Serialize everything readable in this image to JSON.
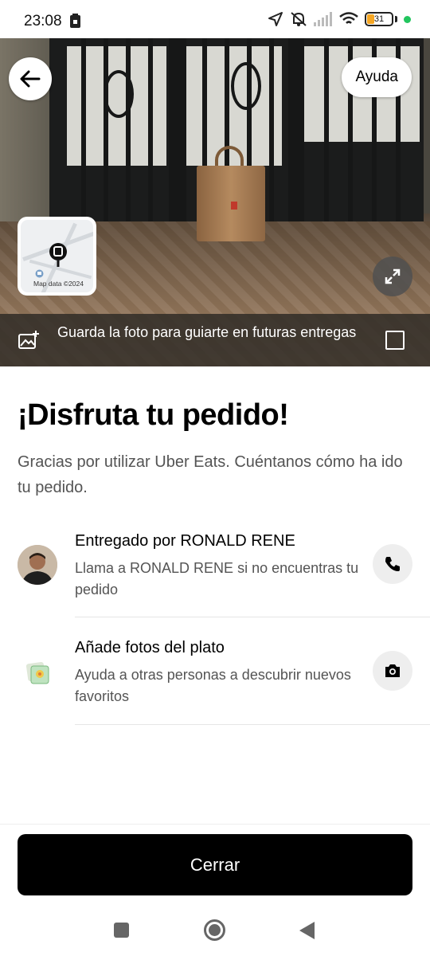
{
  "status_bar": {
    "time": "23:08",
    "battery_level": "31",
    "battery_fraction": 0.31,
    "icons": [
      "save-icon",
      "location-arrow-icon",
      "muted-bell-icon",
      "signal-icon",
      "wifi-icon",
      "battery-icon",
      "status-dot-icon"
    ],
    "accent_color": "#22c55e"
  },
  "header": {
    "help_label": "Ayuda",
    "back_icon": "arrow-left-icon",
    "expand_icon": "expand-icon"
  },
  "map": {
    "attribution": "Map data ©2024"
  },
  "save_photo": {
    "text": "Guarda la foto para guiarte en futuras entregas",
    "checked": false
  },
  "main": {
    "title": "¡Disfruta tu pedido!",
    "subtitle": "Gracias por utilizar Uber Eats. Cuéntanos cómo ha ido tu pedido."
  },
  "rows": [
    {
      "title": "Entregado por RONALD RENE",
      "subtitle": "Llama a RONALD RENE si no encuentras tu pedido",
      "action_icon": "phone-icon"
    },
    {
      "title": "Añade fotos del plato",
      "subtitle": "Ayuda a otras personas a descubrir nuevos favoritos",
      "action_icon": "camera-icon"
    }
  ],
  "footer": {
    "close_label": "Cerrar"
  },
  "colors": {
    "primary": "#000000",
    "secondary_text": "#545454",
    "button_bg": "#eeeeee"
  }
}
